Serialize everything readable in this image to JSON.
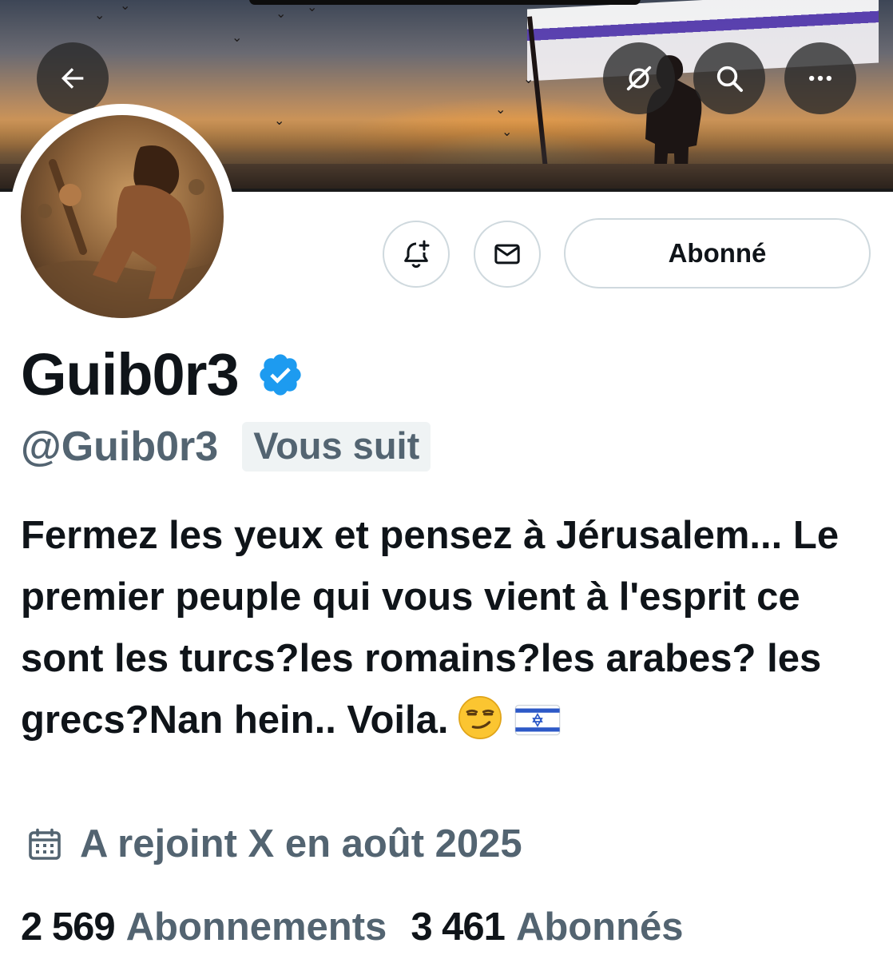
{
  "header": {
    "back_icon": "arrow-left-icon",
    "actions": [
      {
        "icon": "grok-icon"
      },
      {
        "icon": "search-icon"
      },
      {
        "icon": "more-icon"
      }
    ]
  },
  "profile": {
    "display_name": "Guib0r3",
    "handle": "@Guib0r3",
    "follows_you_label": "Vous suit",
    "follow_button_label": "Abonné",
    "bio": "Fermez les yeux et pensez à Jérusalem... Le premier peuple qui vous vient à l'esprit ce sont les turcs?les romains?les arabes? les grecs?Nan hein.. Voila.",
    "joined": "A rejoint X en août 2025",
    "following_count": "2 569",
    "following_label": "Abonnements",
    "followers_count": "3 461",
    "followers_label": "Abonnés"
  },
  "colors": {
    "text_primary": "#0f1419",
    "text_secondary": "#536471",
    "border": "#cfd9de",
    "verified_blue": "#1d9bf0"
  }
}
